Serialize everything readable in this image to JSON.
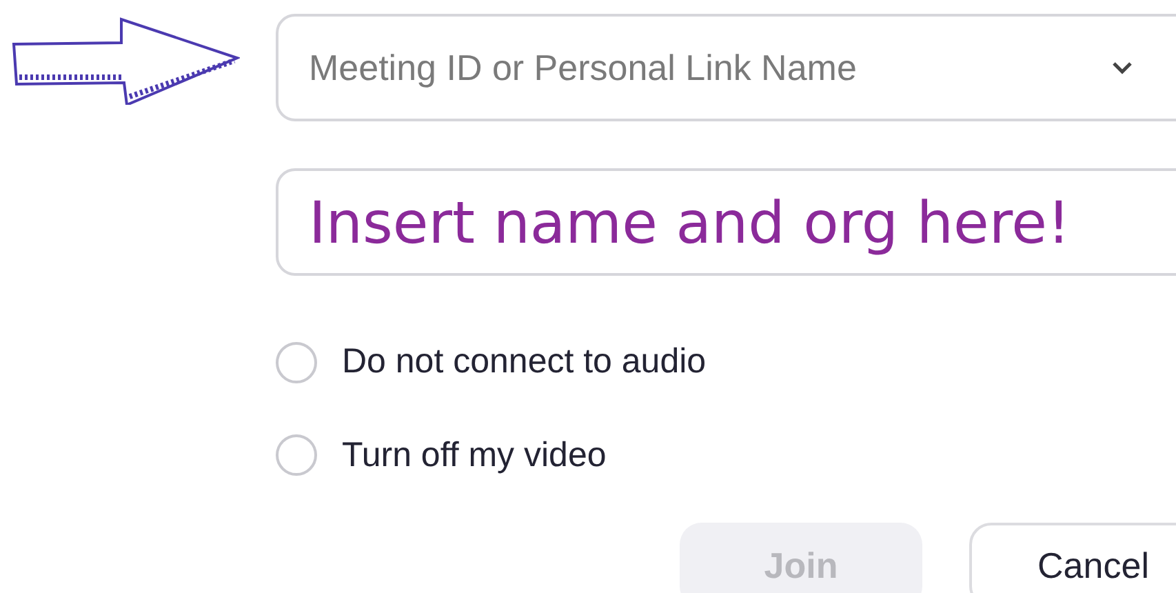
{
  "meeting_field": {
    "placeholder": "Meeting ID or Personal Link Name"
  },
  "name_field": {
    "value": "Insert name and org here!"
  },
  "options": [
    {
      "label": "Do not connect to audio",
      "checked": false
    },
    {
      "label": "Turn off my video",
      "checked": false
    }
  ],
  "buttons": [
    {
      "label": "Join",
      "disabled": true
    },
    {
      "label": "Cancel",
      "disabled": false
    }
  ]
}
